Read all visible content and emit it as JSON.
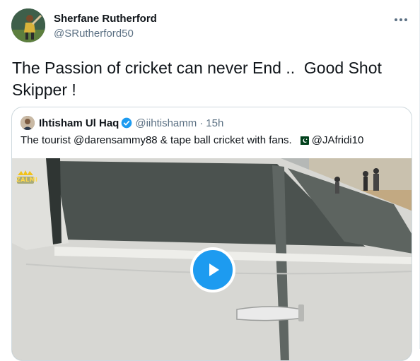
{
  "tweet": {
    "author_name": "Sherfane Rutherford",
    "author_handle": "@SRutherford50",
    "text": "The Passion of cricket can never End ..  Good Shot Skipper !"
  },
  "quoted_tweet": {
    "author_name": "Ihtisham Ul Haq",
    "author_handle": "@iihtishamm",
    "separator": "·",
    "time": "15h",
    "text": "The tourist @darensammy88 & tape ball cricket with fans.",
    "mention": "@JAfridi10",
    "flag_icon": "pakistan-flag-icon",
    "video_badge": "ZALMI",
    "play_icon": "play-icon"
  },
  "colors": {
    "accent": "#1d9bf0",
    "secondary_text": "#5b7083",
    "border": "#cfd9de"
  }
}
